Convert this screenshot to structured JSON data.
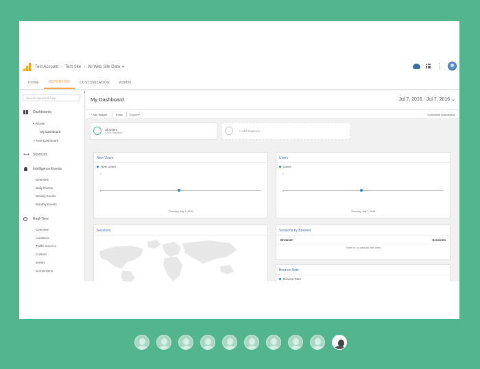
{
  "header": {
    "account": "Test Account",
    "property": "Test Site",
    "view": "All Web Site Data"
  },
  "tabs": [
    "HOME",
    "REPORTING",
    "CUSTOMIZATION",
    "ADMIN"
  ],
  "active_tab": "REPORTING",
  "sidebar": {
    "search_placeholder": "Search reports & help",
    "dashboards": "Dashboards",
    "private": "▾ Private",
    "my_dashboard": "My Dashboard",
    "new_dashboard": "+ New Dashboard",
    "shortcuts": "Shortcuts",
    "intelligence": "Intelligence Events",
    "intel_items": [
      "Overview",
      "Daily Events",
      "Weekly Events",
      "Monthly Events"
    ],
    "realtime": "Real-Time",
    "realtime_items": [
      "Overview",
      "Locations",
      "Traffic Sources",
      "Content",
      "Events",
      "Conversions"
    ]
  },
  "dashboard": {
    "title": "My Dashboard",
    "date_range": "Jul 7, 2016 - Jul 7, 2016",
    "add_widget": "+ Add Widget",
    "email": "Email",
    "export": "Export ▾",
    "customize": "Customize Dashboard"
  },
  "segments": {
    "all_users": "All Users",
    "all_users_pct": "0.00% Sessions",
    "add_segment": "+ Add Segment"
  },
  "widgets": {
    "new_users": {
      "title": "New Users",
      "legend": "New Users",
      "y_top": "1",
      "y_zero": "0",
      "x_label": "Thursday, July 7, 2016"
    },
    "users": {
      "title": "Users",
      "legend": "Users",
      "y_top": "1",
      "y_zero": "0",
      "x_label": "Thursday, July 7, 2016"
    },
    "sessions": {
      "title": "Sessions"
    },
    "sessions_by_browser": {
      "title": "Sessions by Browser",
      "col1": "Browser",
      "col2": "Sessions",
      "empty": "There is no data for this view"
    },
    "bounce_rate": {
      "title": "Bounce Rate",
      "legend": "Bounce Rate"
    }
  },
  "colors": {
    "background": "#52b58e",
    "accent": "#f4a74a",
    "series": "#1a87c9",
    "link": "#4a6fa5"
  },
  "avatars": {
    "count": 10,
    "current_index": 9
  }
}
